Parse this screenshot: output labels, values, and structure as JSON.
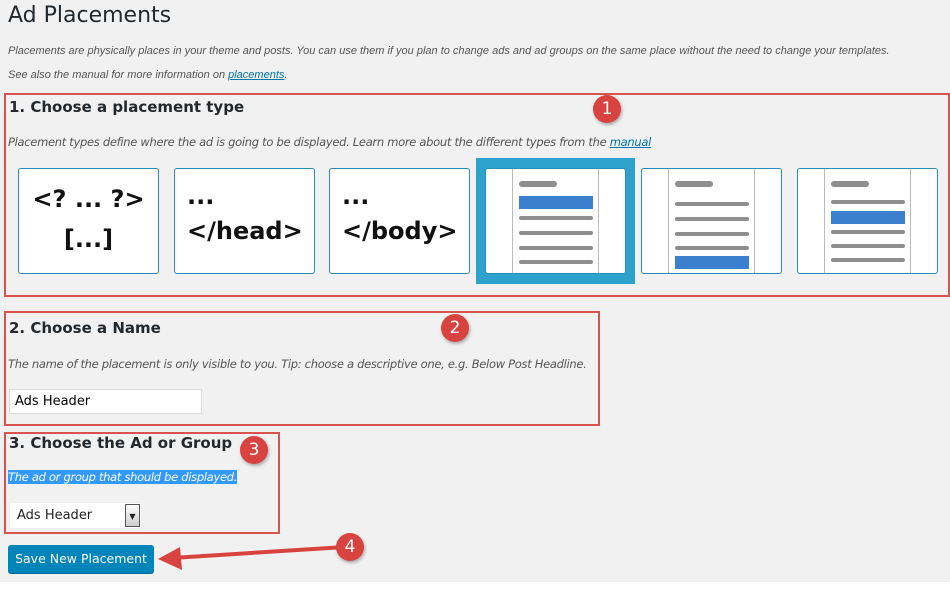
{
  "page": {
    "title": "Ad Placements",
    "description": "Placements are physically places in your theme and posts. You can use them if you plan to change ads and ad groups on the same place without the need to change your templates.",
    "manual_prefix": "See also the manual for more information on ",
    "manual_link": "placements",
    "manual_suffix": "."
  },
  "step1": {
    "heading": "1. Choose a placement type",
    "badge": "1",
    "description": "Placement types define where the ad is going to be displayed. Learn more about the different types from the ",
    "link": "manual",
    "types": [
      {
        "line1": "<? ... ?>",
        "line2": "[...]"
      },
      {
        "line1": "...",
        "line2": "</head>"
      },
      {
        "line1": "...",
        "line2": "</body>"
      },
      {
        "icon": "before-content-icon",
        "selected": true
      },
      {
        "icon": "after-content-icon"
      },
      {
        "icon": "content-icon"
      }
    ]
  },
  "step2": {
    "heading": "2. Choose a Name",
    "badge": "2",
    "description": "The name of the placement is only visible to you. Tip: choose a descriptive one, e.g. Below Post Headline.",
    "value": "Ads Header"
  },
  "step3": {
    "heading": "3. Choose the Ad or Group",
    "badge": "3",
    "description": "The ad or group that should be displayed.",
    "selected": "Ads Header"
  },
  "save": {
    "label": "Save New Placement",
    "badge": "4"
  },
  "colors": {
    "annotation": "#d9433f",
    "primary": "#0085ba",
    "selected": "#2ea2cc",
    "highlight": "#3399ff"
  }
}
